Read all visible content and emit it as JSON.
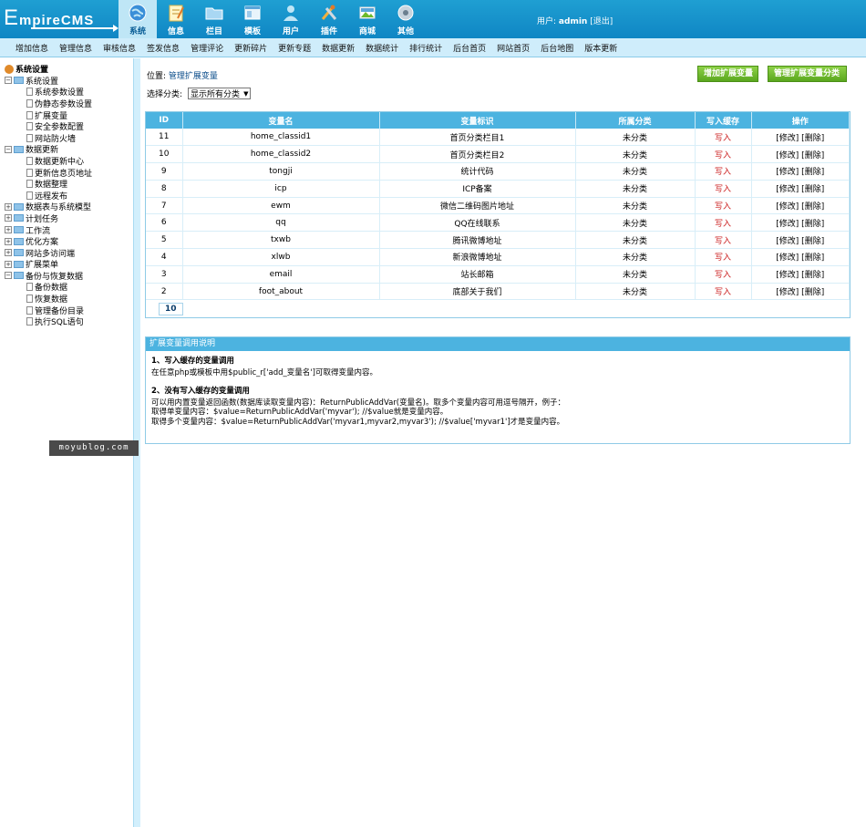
{
  "app": {
    "logo_text": "EmpireCMS",
    "logo_cap": "E",
    "logo_rest": "mpireCMS"
  },
  "topnav": [
    {
      "label": "系统",
      "icon": "globe-icon",
      "active": true
    },
    {
      "label": "信息",
      "icon": "notepad-icon"
    },
    {
      "label": "栏目",
      "icon": "folder-icon"
    },
    {
      "label": "模板",
      "icon": "window-icon"
    },
    {
      "label": "用户",
      "icon": "user-icon"
    },
    {
      "label": "插件",
      "icon": "tools-icon"
    },
    {
      "label": "商城",
      "icon": "image-icon"
    },
    {
      "label": "其他",
      "icon": "gear-icon"
    }
  ],
  "user": {
    "prefix": "用户:",
    "name": "admin",
    "logout": "[退出]"
  },
  "subnav": [
    "增加信息",
    "管理信息",
    "审核信息",
    "签发信息",
    "管理评论",
    "更新碎片",
    "更新专题",
    "数据更新",
    "数据统计",
    "排行统计",
    "后台首页",
    "网站首页",
    "后台地图",
    "版本更新"
  ],
  "tree": {
    "root": "系统设置",
    "groups": [
      {
        "label": "系统设置",
        "expanded": true,
        "children": [
          "系统参数设置",
          "伪静态参数设置",
          "扩展变量",
          "安全参数配置",
          "网站防火墙"
        ]
      },
      {
        "label": "数据更新",
        "expanded": true,
        "children": [
          "数据更新中心",
          "更新信息页地址",
          "数据整理",
          "远程发布"
        ]
      },
      {
        "label": "数据表与系统模型",
        "expanded": false,
        "children": []
      },
      {
        "label": "计划任务",
        "expanded": false,
        "children": []
      },
      {
        "label": "工作流",
        "expanded": false,
        "children": []
      },
      {
        "label": "优化方案",
        "expanded": false,
        "children": []
      },
      {
        "label": "网站多访问端",
        "expanded": false,
        "children": []
      },
      {
        "label": "扩展菜单",
        "expanded": false,
        "children": []
      },
      {
        "label": "备份与恢复数据",
        "expanded": true,
        "children": [
          "备份数据",
          "恢复数据",
          "管理备份目录",
          "执行SQL语句"
        ]
      }
    ]
  },
  "main": {
    "location_prefix": "位置:",
    "location_link": "管理扩展变量",
    "btn_add": "增加扩展变量",
    "btn_manage": "管理扩展变量分类",
    "filter_label": "选择分类:",
    "filter_value": "显示所有分类",
    "table": {
      "headers": [
        "ID",
        "变量名",
        "变量标识",
        "所属分类",
        "写入缓存",
        "操作"
      ],
      "rows": [
        [
          "11",
          "home_classid1",
          "首页分类栏目1",
          "未分类",
          "写入",
          "[修改] [删除]"
        ],
        [
          "10",
          "home_classid2",
          "首页分类栏目2",
          "未分类",
          "写入",
          "[修改] [删除]"
        ],
        [
          "9",
          "tongji",
          "统计代码",
          "未分类",
          "写入",
          "[修改] [删除]"
        ],
        [
          "8",
          "icp",
          "ICP备案",
          "未分类",
          "写入",
          "[修改] [删除]"
        ],
        [
          "7",
          "ewm",
          "微信二维码图片地址",
          "未分类",
          "写入",
          "[修改] [删除]"
        ],
        [
          "6",
          "qq",
          "QQ在线联系",
          "未分类",
          "写入",
          "[修改] [删除]"
        ],
        [
          "5",
          "txwb",
          "腾讯微博地址",
          "未分类",
          "写入",
          "[修改] [删除]"
        ],
        [
          "4",
          "xlwb",
          "新浪微博地址",
          "未分类",
          "写入",
          "[修改] [删除]"
        ],
        [
          "3",
          "email",
          "站长邮箱",
          "未分类",
          "写入",
          "[修改] [删除]"
        ],
        [
          "2",
          "foot_about",
          "底部关于我们",
          "未分类",
          "写入",
          "[修改] [删除]"
        ]
      ],
      "pager": "10"
    },
    "help": {
      "title": "扩展变量调用说明",
      "s1_title": "1、写入缓存的变量调用",
      "s1_text": "在任意php或模板中用$public_r['add_变量名']可取得变量内容。",
      "s2_title": "2、没有写入缓存的变量调用",
      "s2_line1": "可以用内置变量返回函数(数据库读取变量内容)：ReturnPublicAddVar(变量名)。取多个变量内容可用逗号隔开，例子：",
      "s2_line2": "取得单变量内容：$value=ReturnPublicAddVar('myvar'); //$value就是变量内容。",
      "s2_line3": "取得多个变量内容：$value=ReturnPublicAddVar('myvar1,myvar2,myvar3'); //$value['myvar1']才是变量内容。"
    }
  },
  "watermark": "moyublog.com",
  "colors": {
    "header": "#1191cb",
    "accent_blue": "#4cb3e0",
    "green_button": "#6cba2a",
    "red_text": "#cc2020"
  }
}
